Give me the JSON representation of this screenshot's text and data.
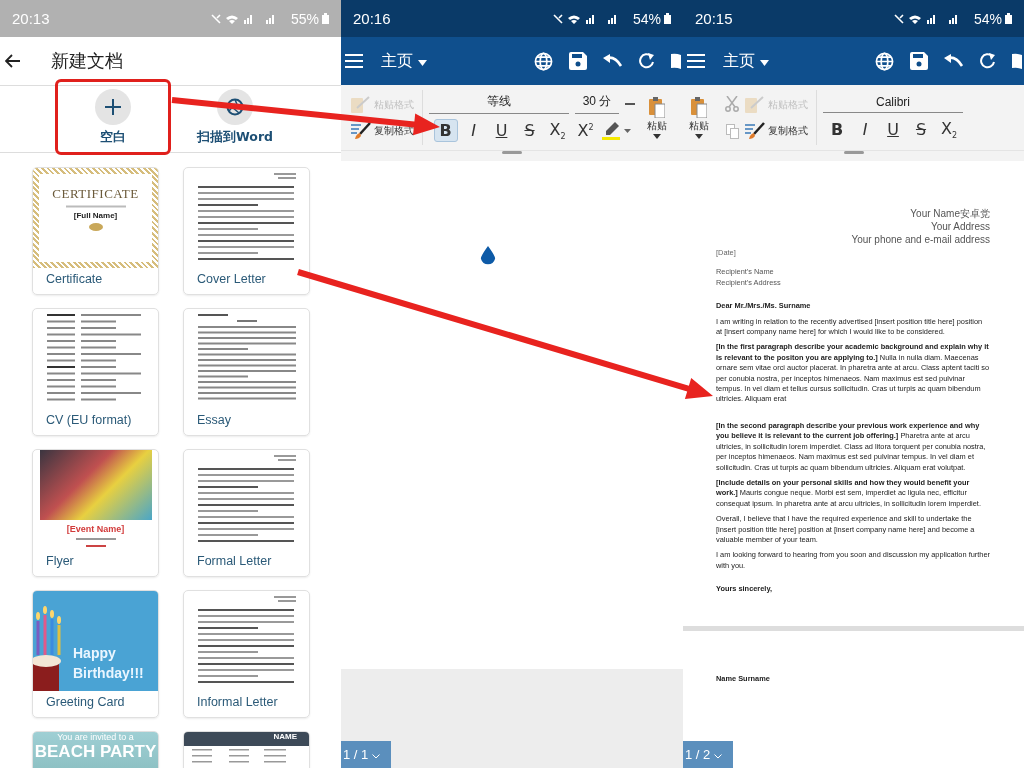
{
  "screens": [
    {
      "kind": "template_picker",
      "status_bar": {
        "time": "20:13",
        "battery": "55%"
      },
      "title": "新建文档",
      "actions": [
        {
          "label": "空白",
          "highlighted": true
        },
        {
          "label": "扫描到Word",
          "highlighted": false
        }
      ],
      "templates": [
        {
          "name": "Certificate",
          "preview": {
            "kind": "certificate",
            "heading": "CERTIFICATE",
            "subtitle": "[Full Name]"
          }
        },
        {
          "name": "Cover Letter",
          "preview": {
            "kind": "letter"
          }
        },
        {
          "name": "CV (EU format)",
          "preview": {
            "kind": "form"
          }
        },
        {
          "name": "Essay",
          "preview": {
            "kind": "essay"
          }
        },
        {
          "name": "Flyer",
          "preview": {
            "kind": "flyer",
            "heading": "[Event Name]"
          }
        },
        {
          "name": "Formal Letter",
          "preview": {
            "kind": "letter"
          }
        },
        {
          "name": "Greeting Card",
          "preview": {
            "kind": "card",
            "heading": "Happy Birthday!!!"
          }
        },
        {
          "name": "Informal Letter",
          "preview": {
            "kind": "letter"
          }
        },
        {
          "preview": {
            "kind": "banner",
            "subtitle": "You are invited to a",
            "heading": "BEACH PARTY"
          }
        },
        {
          "preview": {
            "kind": "resume",
            "heading": "NAME"
          }
        }
      ]
    },
    {
      "kind": "editor",
      "status_bar": {
        "time": "20:16",
        "battery": "54%"
      },
      "menu_label": "主页",
      "ribbon": [
        {
          "kind": "clipboard",
          "items": [
            {
              "label": "粘贴格式",
              "disabled": true
            },
            {
              "label": "复制格式",
              "disabled": false
            }
          ]
        },
        {
          "kind": "font",
          "font": "等线",
          "size": "30 分",
          "buttons": [
            {
              "label": "B",
              "selected": true
            },
            {
              "label": "I",
              "selected": false
            },
            {
              "label": "U",
              "selected": false
            },
            {
              "label": "S",
              "selected": false
            },
            {
              "label": "X$_{2}$",
              "selected": false
            },
            {
              "label": "X$^{2}$",
              "selected": false
            }
          ],
          "highlighter": true
        },
        {
          "kind": "paste",
          "label": "粘贴"
        }
      ],
      "document": {
        "kind": "blank",
        "cursor_handle": true
      },
      "page_indicator": "1 / 1"
    },
    {
      "kind": "editor",
      "status_bar": {
        "time": "20:15",
        "battery": "54%"
      },
      "menu_label": "主页",
      "ribbon": [
        {
          "kind": "paste",
          "label": "粘贴"
        },
        {
          "kind": "clipboard",
          "edit_icons": true,
          "items": [
            {
              "label": "粘贴格式",
              "disabled": true
            },
            {
              "label": "复制格式",
              "disabled": false
            }
          ]
        },
        {
          "kind": "font",
          "font": "Calibri",
          "buttons": [
            {
              "label": "B",
              "selected": false
            },
            {
              "label": "I",
              "selected": false
            },
            {
              "label": "U",
              "selected": false
            },
            {
              "label": "S",
              "selected": false
            },
            {
              "label": "X$_{2}$",
              "selected": false
            }
          ]
        }
      ],
      "document": {
        "kind": "letter",
        "sender": [
          "Your Name安卓党",
          "Your Address",
          "Your phone and e-mail address"
        ],
        "date": "[Date]",
        "recipient": [
          "Recipient's Name",
          "Recipient's Address"
        ],
        "greeting": "Dear Mr./Mrs./Ms. Surname",
        "paragraphs": [
          "I am writing in relation to the recently advertised [insert position title here] position at [insert company name here] for which I would like to be considered.",
          "**[In the first paragraph describe your academic background and explain why it is relevant to the positon you are applying to.]** Nulla in nulla diam. Maecenas ornare sem vitae orci auctor placerat. In pharetra ante at arcu. Class aptent taciti so per conubia nostra, per inceptos himenaeos. Nam maximus est sed pulvinar tempus. In vel diam et tellus cursus sollicitudin. Cras ut turpis ac quam bibendum ultricies. Aliquam erat",
          "**[In the second paragraph describe your previous work experience and why you believe it is relevant to the current job offering.]** Pharetra ante at arcu ultricies, in sollicitudin lorem imperdiet. Class ad litora torquent per conubia nostra, per inceptos himenaeos. Nam maximus est sed pulvinar tempus. In vel diam et sollicitudin. Cras ut turpis ac quam bibendum ultricies. Aliquam erat volutpat.",
          "**[Include details on your personal skills and how they would benefit your work.]** Mauris congue neque. Morbi est sem, imperdiet ac ligula nec, efficitur consequat ipsum. In pharetra ante at arcu ultricies, in sollicitudin lorem imperdiet.",
          "Overall, I believe that I have the required experience and skill to undertake the [insert position title here] position at [insert company name here] and become a valuable member of your team.",
          "I am looking forward to hearing from you soon and discussion my application further with you."
        ],
        "closing": "Yours sincerely,",
        "next_page": "Name Surname"
      },
      "page_indicator": "1 / 2"
    }
  ],
  "arrows": [
    {
      "kind": "arrow"
    },
    {
      "kind": "arrow"
    }
  ]
}
